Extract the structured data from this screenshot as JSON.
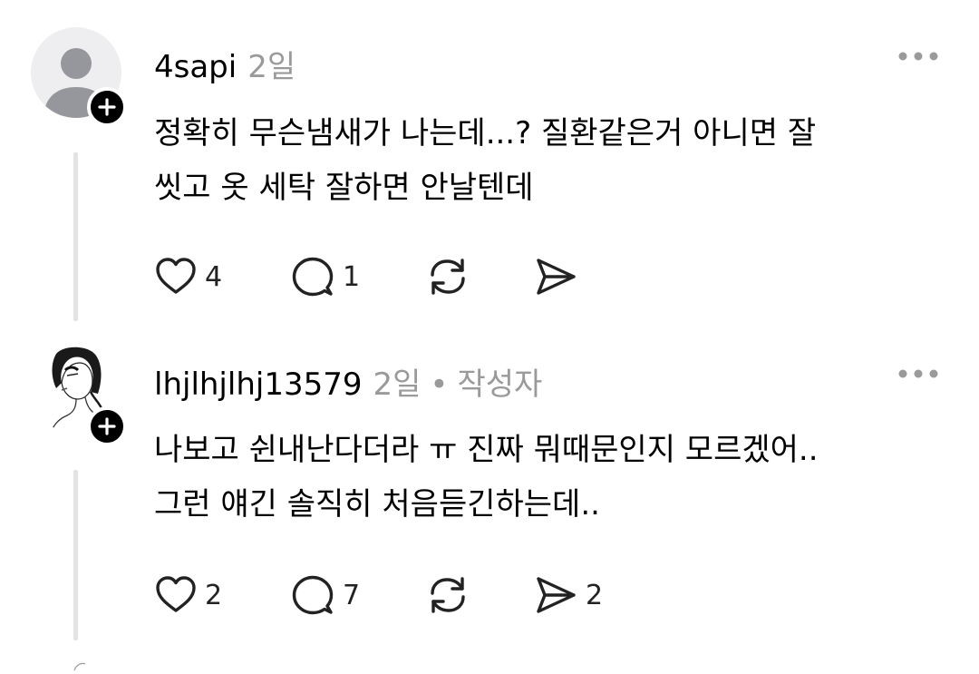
{
  "comments": [
    {
      "username": "4sapi",
      "time": "2일",
      "author_tag": "",
      "text_lines": [
        "정확히 무슨냄새가 나는데...? 질환같은거 아니면 잘",
        "씻고 옷 세탁 잘하면 안날텐데"
      ],
      "likes": "4",
      "replies": "1",
      "reposts": "",
      "shares": ""
    },
    {
      "username": "lhjlhjlhj13579",
      "time": "2일",
      "separator": "•",
      "author_tag": "작성자",
      "text_lines": [
        "나보고 쉰내난다더라 ㅠ 진짜 뭐때문인지 모르겠어..",
        "그런 얘긴 솔직히 처음듣긴하는데.."
      ],
      "likes": "2",
      "replies": "7",
      "reposts": "",
      "shares": "2"
    }
  ],
  "icons": {
    "more": "more-horizontal-icon",
    "like": "heart-icon",
    "reply": "comment-bubble-icon",
    "repost": "repost-icon",
    "share": "send-icon",
    "follow": "plus-icon"
  },
  "colors": {
    "text": "#000000",
    "muted": "#9a9a9a",
    "thread_line": "#e3e3e3",
    "badge": "#000000"
  }
}
